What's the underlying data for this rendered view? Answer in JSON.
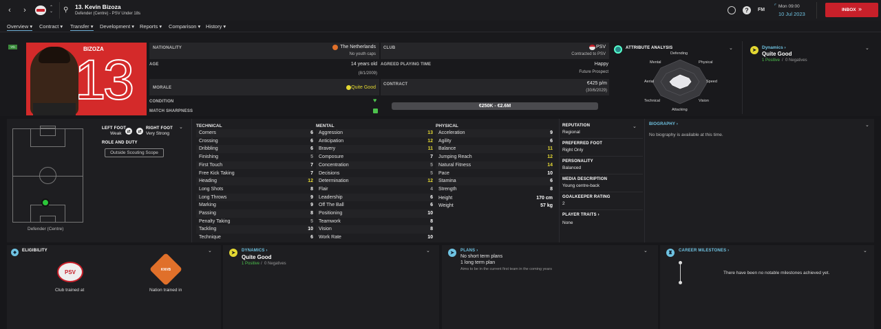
{
  "header": {
    "player_title": "13. Kevin Bizoza",
    "subtitle": "Defender (Centre) - PSV Under 18s",
    "date_time": "Mon 09:00",
    "date": "10 Jul 2023",
    "fm_label": "FM",
    "inbox_label": "INBOX"
  },
  "tabs": [
    {
      "label": "Overview ▾"
    },
    {
      "label": "Contract ▾"
    },
    {
      "label": "Transfer ▾"
    },
    {
      "label": "Development ▾"
    },
    {
      "label": "Reports ▾"
    },
    {
      "label": "Comparison ▾"
    },
    {
      "label": "History ▾"
    }
  ],
  "profile": {
    "badge": "Yth",
    "shirt_name": "BIZOZA",
    "shirt_number": "13",
    "nationality_label": "NATIONALITY",
    "nationality": "The Netherlands",
    "youth_caps": "No youth caps",
    "age_label": "AGE",
    "age": "14 years old",
    "dob": "(8/1/2009)",
    "morale_label": "MORALE",
    "morale": "Quite Good",
    "condition_label": "CONDITION",
    "sharpness_label": "MATCH SHARPNESS",
    "club_label": "CLUB",
    "club": "PSV",
    "contracted_to": "Contracted to PSV",
    "playing_time_label": "AGREED PLAYING TIME",
    "playing_time": "Happy",
    "prospect": "Future Prospect",
    "contract_label": "CONTRACT",
    "wage": "€425 p/m",
    "expiry": "(30/6/2029)",
    "value_range": "€250K - €2.6M"
  },
  "attribute_analysis": {
    "title": "ATTRIBUTE ANALYSIS",
    "labels": [
      "Defending",
      "Physical",
      "Speed",
      "Vision",
      "Attacking",
      "Technical",
      "Aerial",
      "Mental"
    ]
  },
  "dynamics_top": {
    "title": "Dynamics ›",
    "status": "Quite Good",
    "positive": "1 Positive",
    "sep": "/",
    "negative": "0 Negatives"
  },
  "pitch": {
    "position": "Defender (Centre)",
    "left_foot_label": "LEFT FOOT",
    "left_foot": "Weak",
    "right_foot_label": "RIGHT FOOT",
    "right_foot": "Very Strong",
    "role_label": "ROLE AND DUTY",
    "scope_button": "Outside Scouting Scope"
  },
  "technical": {
    "title": "TECHNICAL",
    "rows": [
      [
        "Corners",
        "6"
      ],
      [
        "Crossing",
        "6"
      ],
      [
        "Dribbling",
        "6"
      ],
      [
        "Finishing",
        "5"
      ],
      [
        "First Touch",
        "7"
      ],
      [
        "Free Kick Taking",
        "7"
      ],
      [
        "Heading",
        "12"
      ],
      [
        "Long Shots",
        "8"
      ],
      [
        "Long Throws",
        "9"
      ],
      [
        "Marking",
        "9"
      ],
      [
        "Passing",
        "8"
      ],
      [
        "Penalty Taking",
        "5"
      ],
      [
        "Tackling",
        "10"
      ],
      [
        "Technique",
        "6"
      ]
    ]
  },
  "mental": {
    "title": "MENTAL",
    "rows": [
      [
        "Aggression",
        "13"
      ],
      [
        "Anticipation",
        "12"
      ],
      [
        "Bravery",
        "11"
      ],
      [
        "Composure",
        "7"
      ],
      [
        "Concentration",
        "5"
      ],
      [
        "Decisions",
        "5"
      ],
      [
        "Determination",
        "12"
      ],
      [
        "Flair",
        "4"
      ],
      [
        "Leadership",
        "6"
      ],
      [
        "Off The Ball",
        "6"
      ],
      [
        "Positioning",
        "10"
      ],
      [
        "Teamwork",
        "8"
      ],
      [
        "Vision",
        "8"
      ],
      [
        "Work Rate",
        "10"
      ]
    ]
  },
  "physical": {
    "title": "PHYSICAL",
    "rows": [
      [
        "Acceleration",
        "9"
      ],
      [
        "Agility",
        "6"
      ],
      [
        "Balance",
        "11"
      ],
      [
        "Jumping Reach",
        "12"
      ],
      [
        "Natural Fitness",
        "14"
      ],
      [
        "Pace",
        "10"
      ],
      [
        "Stamina",
        "6"
      ],
      [
        "Strength",
        "8"
      ]
    ],
    "height_label": "Height",
    "height": "170 cm",
    "weight_label": "Weight",
    "weight": "57 kg"
  },
  "info": {
    "reputation_label": "REPUTATION",
    "reputation": "Regional",
    "foot_label": "PREFERRED FOOT",
    "foot": "Right Only",
    "personality_label": "PERSONALITY",
    "personality": "Balanced",
    "media_label": "MEDIA DESCRIPTION",
    "media": "Young centre-back",
    "gk_label": "GOALKEEPER RATING",
    "gk": "2",
    "traits_label": "PLAYER TRAITS ›",
    "traits": "None"
  },
  "biography": {
    "title": "BIOGRAPHY ›",
    "text": "No biography is available at this time."
  },
  "eligibility": {
    "title": "ELIGIBILITY",
    "club_label": "Club trained at",
    "nation_label": "Nation trained in",
    "club_badge": "PSV",
    "nation_badge": "KNVB"
  },
  "dynamics_bottom": {
    "title": "DYNAMICS ›",
    "status": "Quite Good",
    "positive": "1 Positive",
    "sep": "/",
    "negative": "0 Negatives"
  },
  "plans": {
    "title": "PLANS ›",
    "line1": "No short term plans",
    "line2": "1 long term plan",
    "line3": "Aims to be in the current first team in the coming years"
  },
  "milestones": {
    "title": "CAREER MILESTONES ›",
    "text": "There have been no notable milestones achieved yet."
  },
  "colors": {
    "accent_red": "#c8202a",
    "highlight_yellow": "#e4d832",
    "link_blue": "#6fc3e2",
    "positive_green": "#4dc24d"
  }
}
